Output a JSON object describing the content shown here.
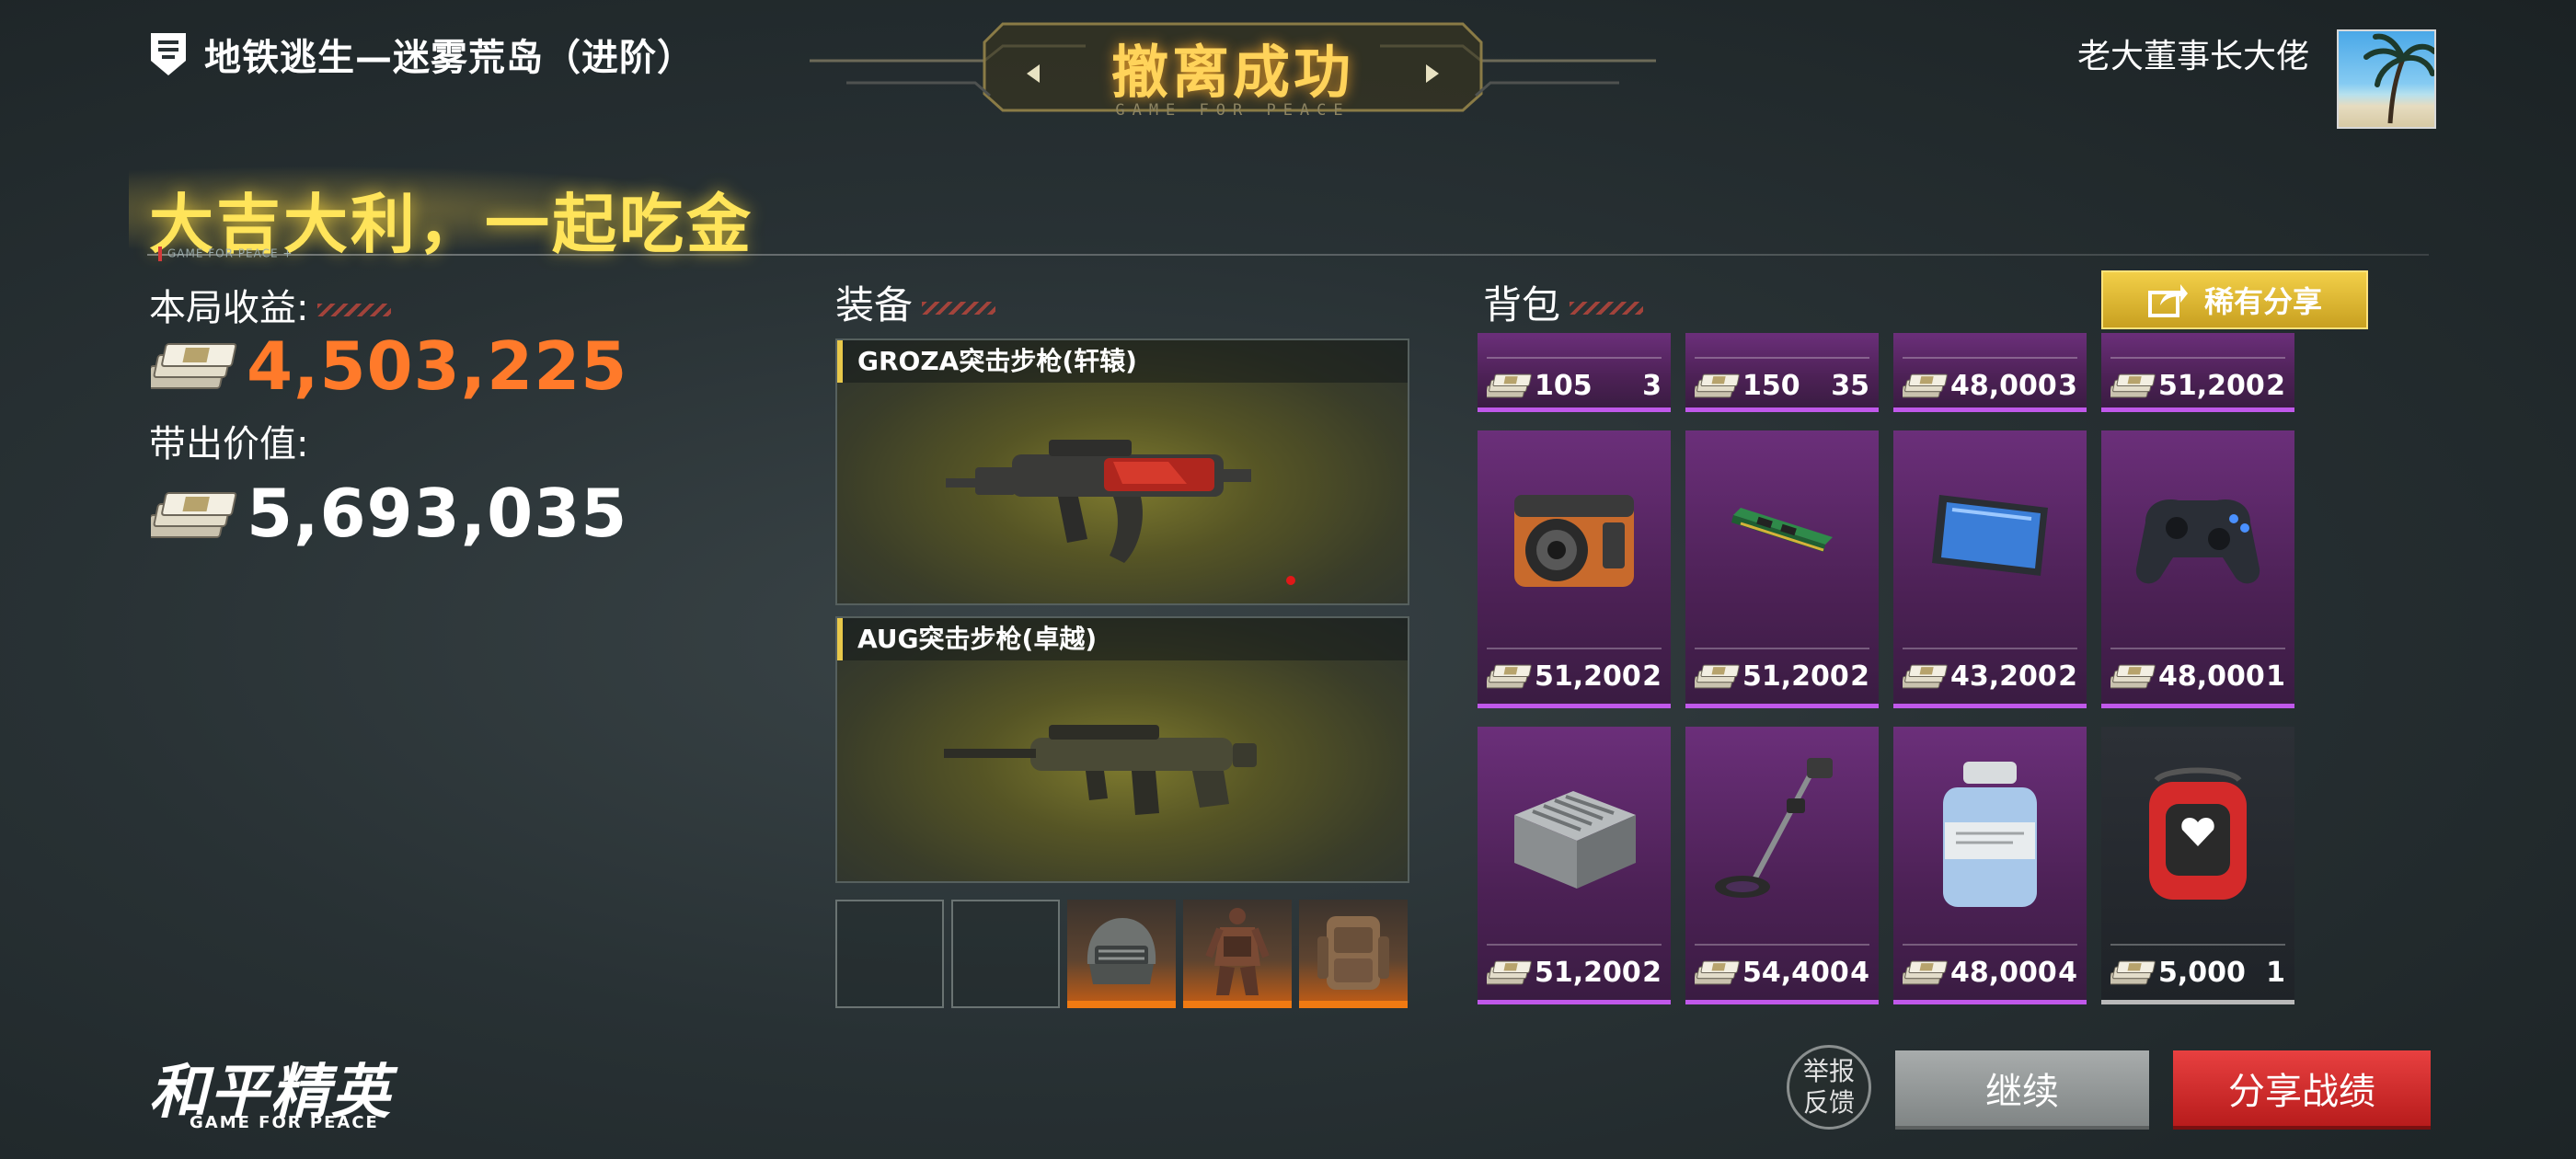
{
  "header": {
    "mode_title": "地铁逃生—迷雾荒岛（进阶）",
    "banner_title": "撤离成功",
    "banner_subtitle": "GAME FOR PEACE",
    "player_name": "老大董事长大佬"
  },
  "slogan": "大吉大利，一起吃金",
  "divider_mark": "GAME FOR PEACE",
  "stats": {
    "earnings_label": "本局收益:",
    "earnings_value": "4,503,225",
    "carry_label": "带出价值:",
    "carry_value": "5,693,035"
  },
  "equipment": {
    "title": "装备",
    "weapons": [
      {
        "name": "GROZA突击步枪(轩辕)"
      },
      {
        "name": "AUG突击步枪(卓越)"
      }
    ],
    "slots": [
      "empty",
      "empty",
      "helmet-icon",
      "armor-vest-icon",
      "backpack-icon"
    ]
  },
  "backpack": {
    "title": "背包",
    "share_label": "稀有分享",
    "items": [
      {
        "price": "105",
        "qty": "3"
      },
      {
        "price": "150",
        "qty": "35"
      },
      {
        "price": "48,000",
        "qty": "3"
      },
      {
        "price": "51,200",
        "qty": "2"
      },
      {
        "price": "51,200",
        "qty": "2",
        "icon": "camera-icon"
      },
      {
        "price": "51,200",
        "qty": "2",
        "icon": "ram-stick-icon"
      },
      {
        "price": "43,200",
        "qty": "2",
        "icon": "tablet-icon"
      },
      {
        "price": "48,000",
        "qty": "1",
        "icon": "gamepad-icon"
      },
      {
        "price": "51,200",
        "qty": "2",
        "icon": "circuit-box-icon"
      },
      {
        "price": "54,400",
        "qty": "4",
        "icon": "metal-detector-icon"
      },
      {
        "price": "48,000",
        "qty": "4",
        "icon": "pill-bottle-icon"
      },
      {
        "price": "5,000",
        "qty": "1",
        "icon": "aed-icon"
      }
    ]
  },
  "logo": {
    "main": "和平精英",
    "sub": "GAME FOR PEACE"
  },
  "buttons": {
    "report_line1": "举报",
    "report_line2": "反馈",
    "continue": "继续",
    "share_battle": "分享战绩"
  },
  "colors": {
    "earnings": "#ff7a2a",
    "slogan": "#ffe45a",
    "item_epic": "#c058ea",
    "share_button": "#e8c030",
    "share_battle_button": "#d02a2a"
  }
}
